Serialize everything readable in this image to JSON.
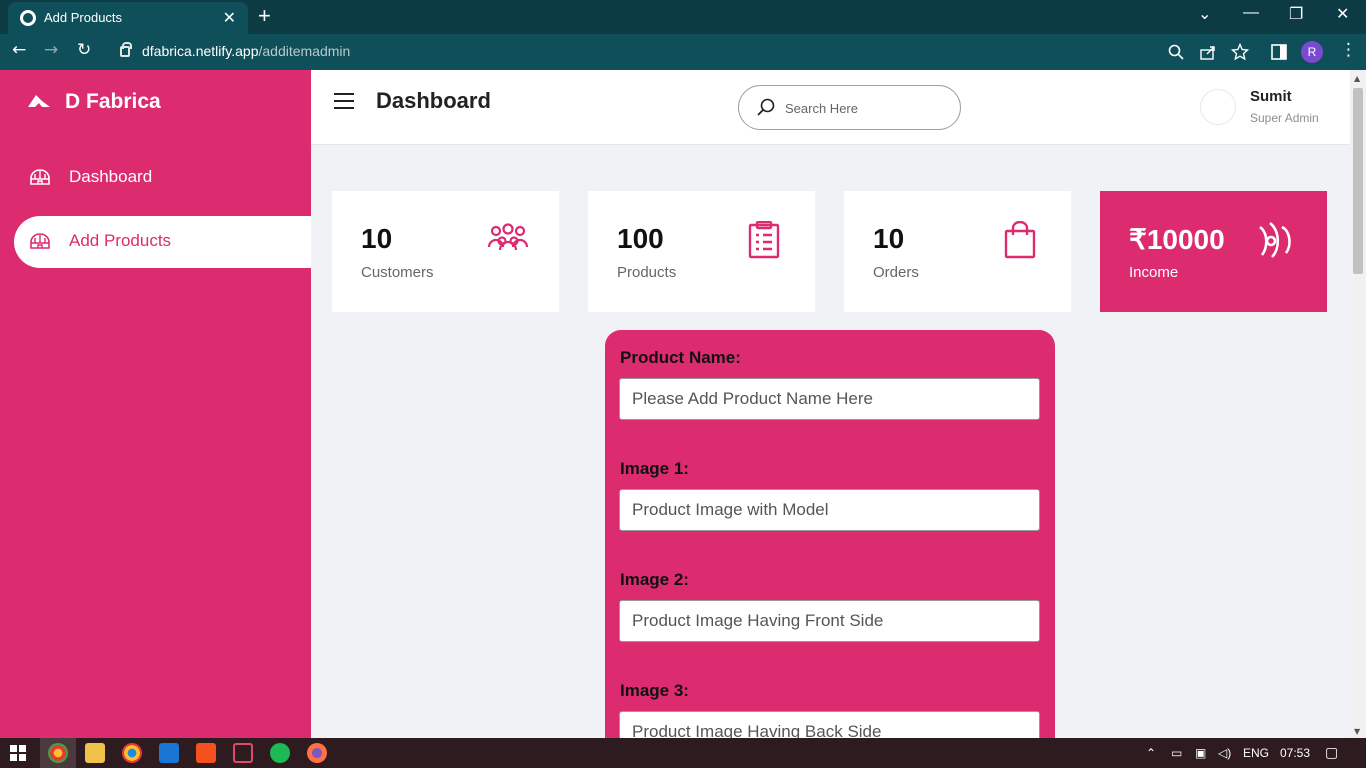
{
  "browser": {
    "tab_title": "Add Products",
    "tab_close": "✕",
    "new_tab": "+",
    "url_host": "dfabrica.netlify.app",
    "url_path": "/additemadmin",
    "profile_initial": "R",
    "window_controls": [
      "⌄",
      "—",
      "❐",
      "✕"
    ]
  },
  "sidebar": {
    "brand": "D Fabrica",
    "items": [
      {
        "label": "Dashboard",
        "icon": "igloo-icon",
        "active": false
      },
      {
        "label": "Add Products",
        "icon": "igloo-icon",
        "active": true
      }
    ]
  },
  "header": {
    "title": "Dashboard",
    "search_placeholder": "Search Here",
    "user_name": "Sumit",
    "user_role": "Super Admin"
  },
  "cards": [
    {
      "value": "10",
      "label": "Customers",
      "icon": "people-icon"
    },
    {
      "value": "100",
      "label": "Products",
      "icon": "clipboard-icon"
    },
    {
      "value": "10",
      "label": "Orders",
      "icon": "shopping-bag-icon"
    },
    {
      "value": "₹10000",
      "label": "Income",
      "icon": "money-icon"
    }
  ],
  "form": {
    "fields": [
      {
        "label": "Product Name:",
        "placeholder": "Please Add Product Name Here"
      },
      {
        "label": "Image 1:",
        "placeholder": "Product Image with Model"
      },
      {
        "label": "Image 2:",
        "placeholder": "Product Image Having Front Side"
      },
      {
        "label": "Image 3:",
        "placeholder": "Product Image Having Back Side"
      }
    ]
  },
  "taskbar": {
    "language": "ENG",
    "time": "07:53"
  },
  "colors": {
    "accent": "#dc2b6e",
    "browser_frame": "#0c3b44",
    "background": "#f0f2f5"
  }
}
